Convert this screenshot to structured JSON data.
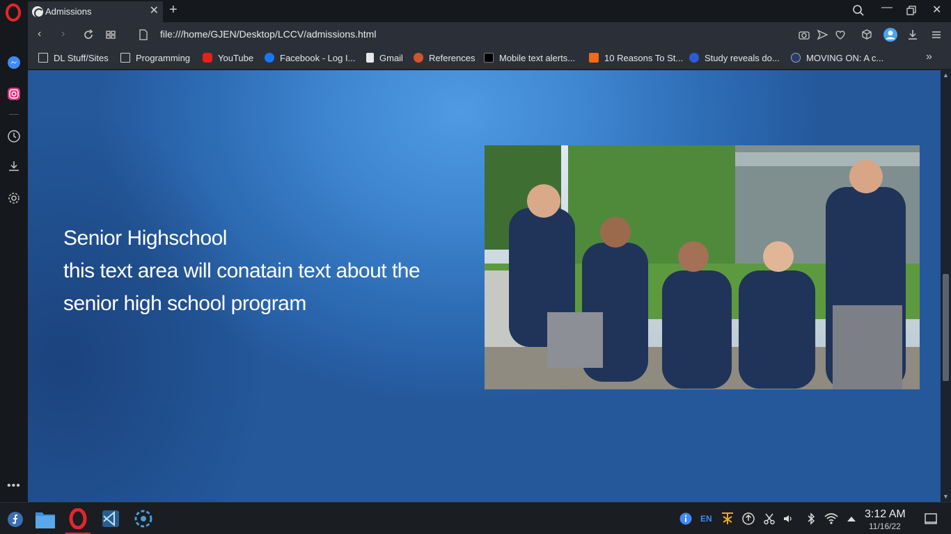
{
  "browser": {
    "tab_title": "Admissions",
    "url": "file:///home/GJEN/Desktop/LCCV/admissions.html"
  },
  "bookmarks": [
    {
      "label": "DL Stuff/Sites",
      "icon": "folder-icon"
    },
    {
      "label": "Programming",
      "icon": "folder-icon"
    },
    {
      "label": "YouTube",
      "icon": "youtube-icon"
    },
    {
      "label": "Facebook - Log I...",
      "icon": "facebook-icon"
    },
    {
      "label": "Gmail",
      "icon": "document-icon"
    },
    {
      "label": "References",
      "icon": "graduation-cap-icon"
    },
    {
      "label": "Mobile text alerts...",
      "icon": "w-icon"
    },
    {
      "label": "10 Reasons To St...",
      "icon": "checkbox-icon"
    },
    {
      "label": "Study reveals do...",
      "icon": "inq-icon"
    },
    {
      "label": "MOVING ON: A c...",
      "icon": "badge-icon"
    }
  ],
  "page": {
    "heading_line1": "Senior Highschool",
    "heading_line2": "this text area will conatain text about the senior high school program"
  },
  "taskbar": {
    "language": "EN",
    "time": "3:12 AM",
    "date": "11/16/22"
  }
}
